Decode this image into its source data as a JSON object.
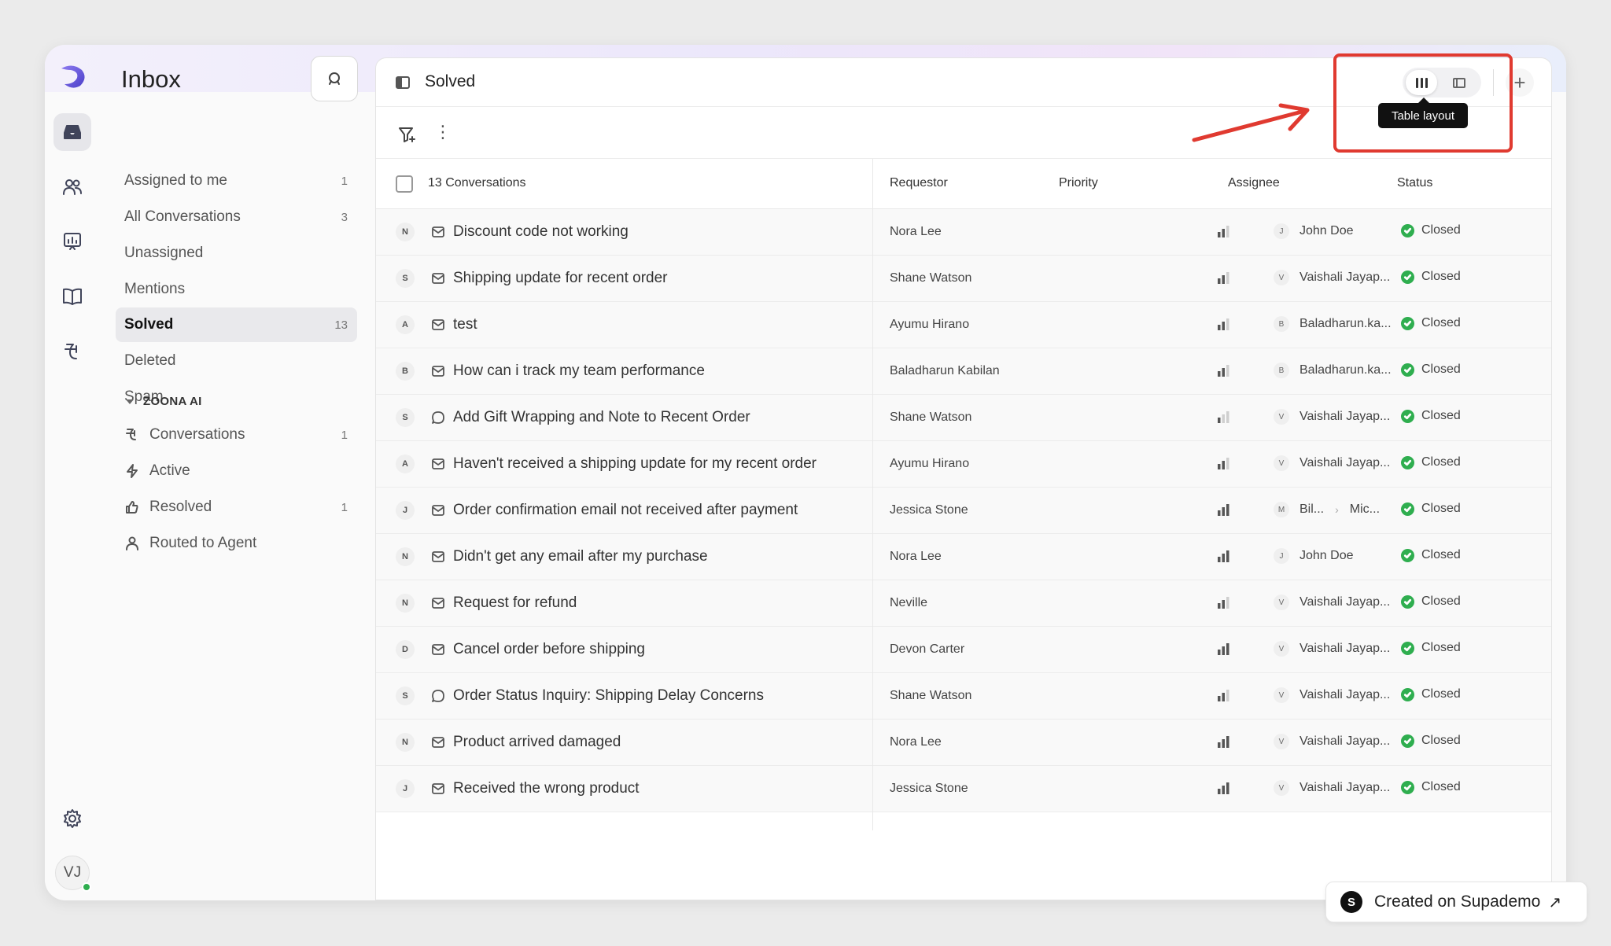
{
  "rail": {
    "avatar_initials": "VJ"
  },
  "sidebar": {
    "title": "Inbox",
    "items": [
      {
        "label": "Assigned to me",
        "count": "1"
      },
      {
        "label": "All Conversations",
        "count": "3"
      },
      {
        "label": "Unassigned",
        "count": ""
      },
      {
        "label": "Mentions",
        "count": ""
      },
      {
        "label": "Solved",
        "count": "13"
      },
      {
        "label": "Deleted",
        "count": ""
      },
      {
        "label": "Spam",
        "count": ""
      }
    ],
    "section_title": "ZOONA AI",
    "ai_items": [
      {
        "label": "Conversations",
        "count": "1"
      },
      {
        "label": "Active",
        "count": ""
      },
      {
        "label": "Resolved",
        "count": "1"
      },
      {
        "label": "Routed to Agent",
        "count": ""
      }
    ]
  },
  "main": {
    "title": "Solved",
    "tooltip": "Table layout",
    "add_label": "+",
    "headers": {
      "conversations": "13 Conversations",
      "requestor": "Requestor",
      "priority": "Priority",
      "assignee": "Assignee",
      "status": "Status"
    },
    "rows": [
      {
        "initial": "N",
        "channel": "email",
        "subject": "Discount code not working",
        "requestor": "Nora Lee",
        "priority": 2,
        "assignee_initial": "J",
        "assignee": "John Doe",
        "status": "Closed"
      },
      {
        "initial": "S",
        "channel": "email",
        "subject": "Shipping update for recent order",
        "requestor": "Shane Watson",
        "priority": 2,
        "assignee_initial": "V",
        "assignee": "Vaishali Jayap...",
        "status": "Closed"
      },
      {
        "initial": "A",
        "channel": "email",
        "subject": "test",
        "requestor": "Ayumu Hirano",
        "priority": 2,
        "assignee_initial": "B",
        "assignee": "Baladharun.ka...",
        "status": "Closed"
      },
      {
        "initial": "B",
        "channel": "email",
        "subject": "How can i track my team performance",
        "requestor": "Baladharun Kabilan",
        "priority": 2,
        "assignee_initial": "B",
        "assignee": "Baladharun.ka...",
        "status": "Closed"
      },
      {
        "initial": "S",
        "channel": "chat",
        "subject": "Add Gift Wrapping and Note to Recent Order",
        "requestor": "Shane Watson",
        "priority": 1,
        "assignee_initial": "V",
        "assignee": "Vaishali Jayap...",
        "status": "Closed"
      },
      {
        "initial": "A",
        "channel": "email",
        "subject": "Haven't received a shipping update for my recent order",
        "requestor": "Ayumu Hirano",
        "priority": 2,
        "assignee_initial": "V",
        "assignee": "Vaishali Jayap...",
        "status": "Closed"
      },
      {
        "initial": "J",
        "channel": "email",
        "subject": "Order confirmation email not received after payment",
        "requestor": "Jessica Stone",
        "priority": 3,
        "assignee_initial": "M",
        "assignee": "Bil...",
        "assignee2": "Mic...",
        "status": "Closed"
      },
      {
        "initial": "N",
        "channel": "email",
        "subject": "Didn't get any email after my purchase",
        "requestor": "Nora Lee",
        "priority": 3,
        "assignee_initial": "J",
        "assignee": "John Doe",
        "status": "Closed"
      },
      {
        "initial": "N",
        "channel": "email",
        "subject": "Request for refund",
        "requestor": "Neville",
        "priority": 2,
        "assignee_initial": "V",
        "assignee": "Vaishali Jayap...",
        "status": "Closed"
      },
      {
        "initial": "D",
        "channel": "email",
        "subject": "Cancel order before shipping",
        "requestor": "Devon Carter",
        "priority": 3,
        "assignee_initial": "V",
        "assignee": "Vaishali Jayap...",
        "status": "Closed"
      },
      {
        "initial": "S",
        "channel": "chat",
        "subject": "Order Status Inquiry: Shipping Delay Concerns",
        "requestor": "Shane Watson",
        "priority": 2,
        "assignee_initial": "V",
        "assignee": "Vaishali Jayap...",
        "status": "Closed"
      },
      {
        "initial": "N",
        "channel": "email",
        "subject": "Product arrived damaged",
        "requestor": "Nora Lee",
        "priority": 3,
        "assignee_initial": "V",
        "assignee": "Vaishali Jayap...",
        "status": "Closed"
      },
      {
        "initial": "J",
        "channel": "email",
        "subject": "Received the wrong product",
        "requestor": "Jessica Stone",
        "priority": 3,
        "assignee_initial": "V",
        "assignee": "Vaishali Jayap...",
        "status": "Closed"
      }
    ]
  },
  "footer": {
    "supademo_logo": "S",
    "supademo_label": "Created on Supademo",
    "supademo_arrow": "↗"
  },
  "colors": {
    "annotation": "#e03a30",
    "status_closed": "#2fae4f"
  }
}
